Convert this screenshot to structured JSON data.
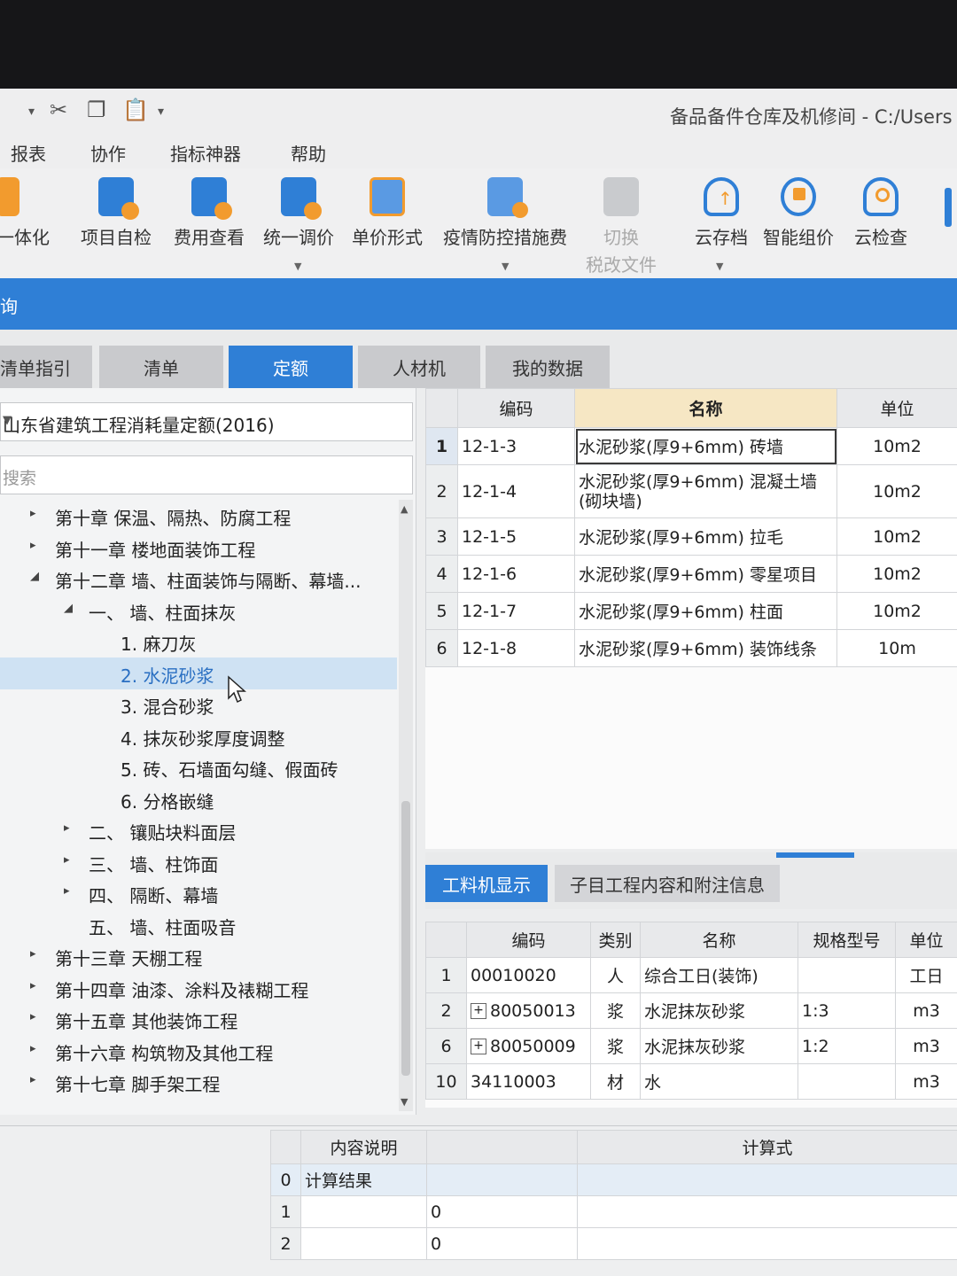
{
  "window": {
    "title": "备品备件仓库及机修间 - C:/Users"
  },
  "quick_access": [
    "cut-icon",
    "copy-icon",
    "paste-icon"
  ],
  "menu": [
    "报表",
    "协作",
    "指标神器",
    "帮助"
  ],
  "ribbon": [
    {
      "label": "一体化",
      "icon": "integration-icon"
    },
    {
      "label": "项目自检",
      "icon": "project-check-icon"
    },
    {
      "label": "费用查看",
      "icon": "cost-view-icon"
    },
    {
      "label": "统一调价",
      "icon": "price-adjust-icon"
    },
    {
      "label": "单价形式",
      "icon": "unit-price-icon"
    },
    {
      "label": "疫情防控措施费",
      "icon": "epidemic-fee-icon"
    },
    {
      "label": "切换",
      "label2": "税改文件",
      "icon": "switch-icon",
      "disabled": true
    },
    {
      "label": "云存档",
      "icon": "cloud-save-icon"
    },
    {
      "label": "智能组价",
      "icon": "smart-pricing-icon"
    },
    {
      "label": "云检查",
      "icon": "cloud-check-icon"
    }
  ],
  "panel_title": "询",
  "tabs": [
    "清单指引",
    "清单",
    "定额",
    "人材机",
    "我的数据"
  ],
  "active_tab": "定额",
  "library_select": "山东省建筑工程消耗量定额(2016)",
  "search_placeholder": "搜索",
  "tree": [
    {
      "text": "第十章 保温、隔热、防腐工程",
      "level": 0,
      "toggle": "▸"
    },
    {
      "text": "第十一章 楼地面装饰工程",
      "level": 0,
      "toggle": "▸"
    },
    {
      "text": "第十二章 墙、柱面装饰与隔断、幕墙...",
      "level": 0,
      "toggle": "◢"
    },
    {
      "text": "一、 墙、柱面抹灰",
      "level": 1,
      "toggle": "◢"
    },
    {
      "text": "1. 麻刀灰",
      "level": 2,
      "toggle": ""
    },
    {
      "text": "2. 水泥砂浆",
      "level": 2,
      "toggle": "",
      "selected": true
    },
    {
      "text": "3. 混合砂浆",
      "level": 2,
      "toggle": ""
    },
    {
      "text": "4. 抹灰砂浆厚度调整",
      "level": 2,
      "toggle": ""
    },
    {
      "text": "5. 砖、石墙面勾缝、假面砖",
      "level": 2,
      "toggle": ""
    },
    {
      "text": "6. 分格嵌缝",
      "level": 2,
      "toggle": ""
    },
    {
      "text": "二、 镶贴块料面层",
      "level": 1,
      "toggle": "▸"
    },
    {
      "text": "三、 墙、柱饰面",
      "level": 1,
      "toggle": "▸"
    },
    {
      "text": "四、 隔断、幕墙",
      "level": 1,
      "toggle": "▸"
    },
    {
      "text": "五、 墙、柱面吸音",
      "level": 1,
      "toggle": ""
    },
    {
      "text": "第十三章 天棚工程",
      "level": 0,
      "toggle": "▸"
    },
    {
      "text": "第十四章 油漆、涂料及裱糊工程",
      "level": 0,
      "toggle": "▸"
    },
    {
      "text": "第十五章 其他装饰工程",
      "level": 0,
      "toggle": "▸"
    },
    {
      "text": "第十六章 构筑物及其他工程",
      "level": 0,
      "toggle": "▸"
    },
    {
      "text": "第十七章 脚手架工程",
      "level": 0,
      "toggle": "▸"
    }
  ],
  "quota_grid": {
    "headers": [
      "",
      "编码",
      "名称",
      "单位"
    ],
    "rows": [
      {
        "no": "1",
        "code": "12-1-3",
        "name": "水泥砂浆(厚9+6mm) 砖墙",
        "unit": "10m2"
      },
      {
        "no": "2",
        "code": "12-1-4",
        "name": "水泥砂浆(厚9+6mm) 混凝土墙(砌块墙)",
        "unit": "10m2"
      },
      {
        "no": "3",
        "code": "12-1-5",
        "name": "水泥砂浆(厚9+6mm) 拉毛",
        "unit": "10m2"
      },
      {
        "no": "4",
        "code": "12-1-6",
        "name": "水泥砂浆(厚9+6mm) 零星项目",
        "unit": "10m2"
      },
      {
        "no": "5",
        "code": "12-1-7",
        "name": "水泥砂浆(厚9+6mm) 柱面",
        "unit": "10m2"
      },
      {
        "no": "6",
        "code": "12-1-8",
        "name": "水泥砂浆(厚9+6mm) 装饰线条",
        "unit": "10m"
      }
    ]
  },
  "sub_tabs": [
    "工料机显示",
    "子目工程内容和附注信息"
  ],
  "resource_grid": {
    "headers": [
      "",
      "编码",
      "类别",
      "名称",
      "规格型号",
      "单位"
    ],
    "rows": [
      {
        "no": "1",
        "expand": "",
        "code": "00010020",
        "type": "人",
        "name": "综合工日(装饰)",
        "spec": "",
        "unit": "工日"
      },
      {
        "no": "2",
        "expand": "+",
        "code": "80050013",
        "type": "浆",
        "name": "水泥抹灰砂浆",
        "spec": "1:3",
        "unit": "m3"
      },
      {
        "no": "6",
        "expand": "+",
        "code": "80050009",
        "type": "浆",
        "name": "水泥抹灰砂浆",
        "spec": "1:2",
        "unit": "m3"
      },
      {
        "no": "10",
        "expand": "",
        "code": "34110003",
        "type": "材",
        "name": "水",
        "spec": "",
        "unit": "m3"
      }
    ]
  },
  "calc_grid": {
    "headers": [
      "",
      "内容说明",
      "",
      "计算式"
    ],
    "rows": [
      {
        "no": "0",
        "desc": "计算结果",
        "val": "",
        "formula": ""
      },
      {
        "no": "1",
        "desc": "",
        "val": "0",
        "formula": ""
      },
      {
        "no": "2",
        "desc": "",
        "val": "0",
        "formula": ""
      }
    ]
  },
  "colors": {
    "accent": "#2f7fd6",
    "header_highlight": "#f6e7c4",
    "selected_row": "#cfe2f3"
  }
}
